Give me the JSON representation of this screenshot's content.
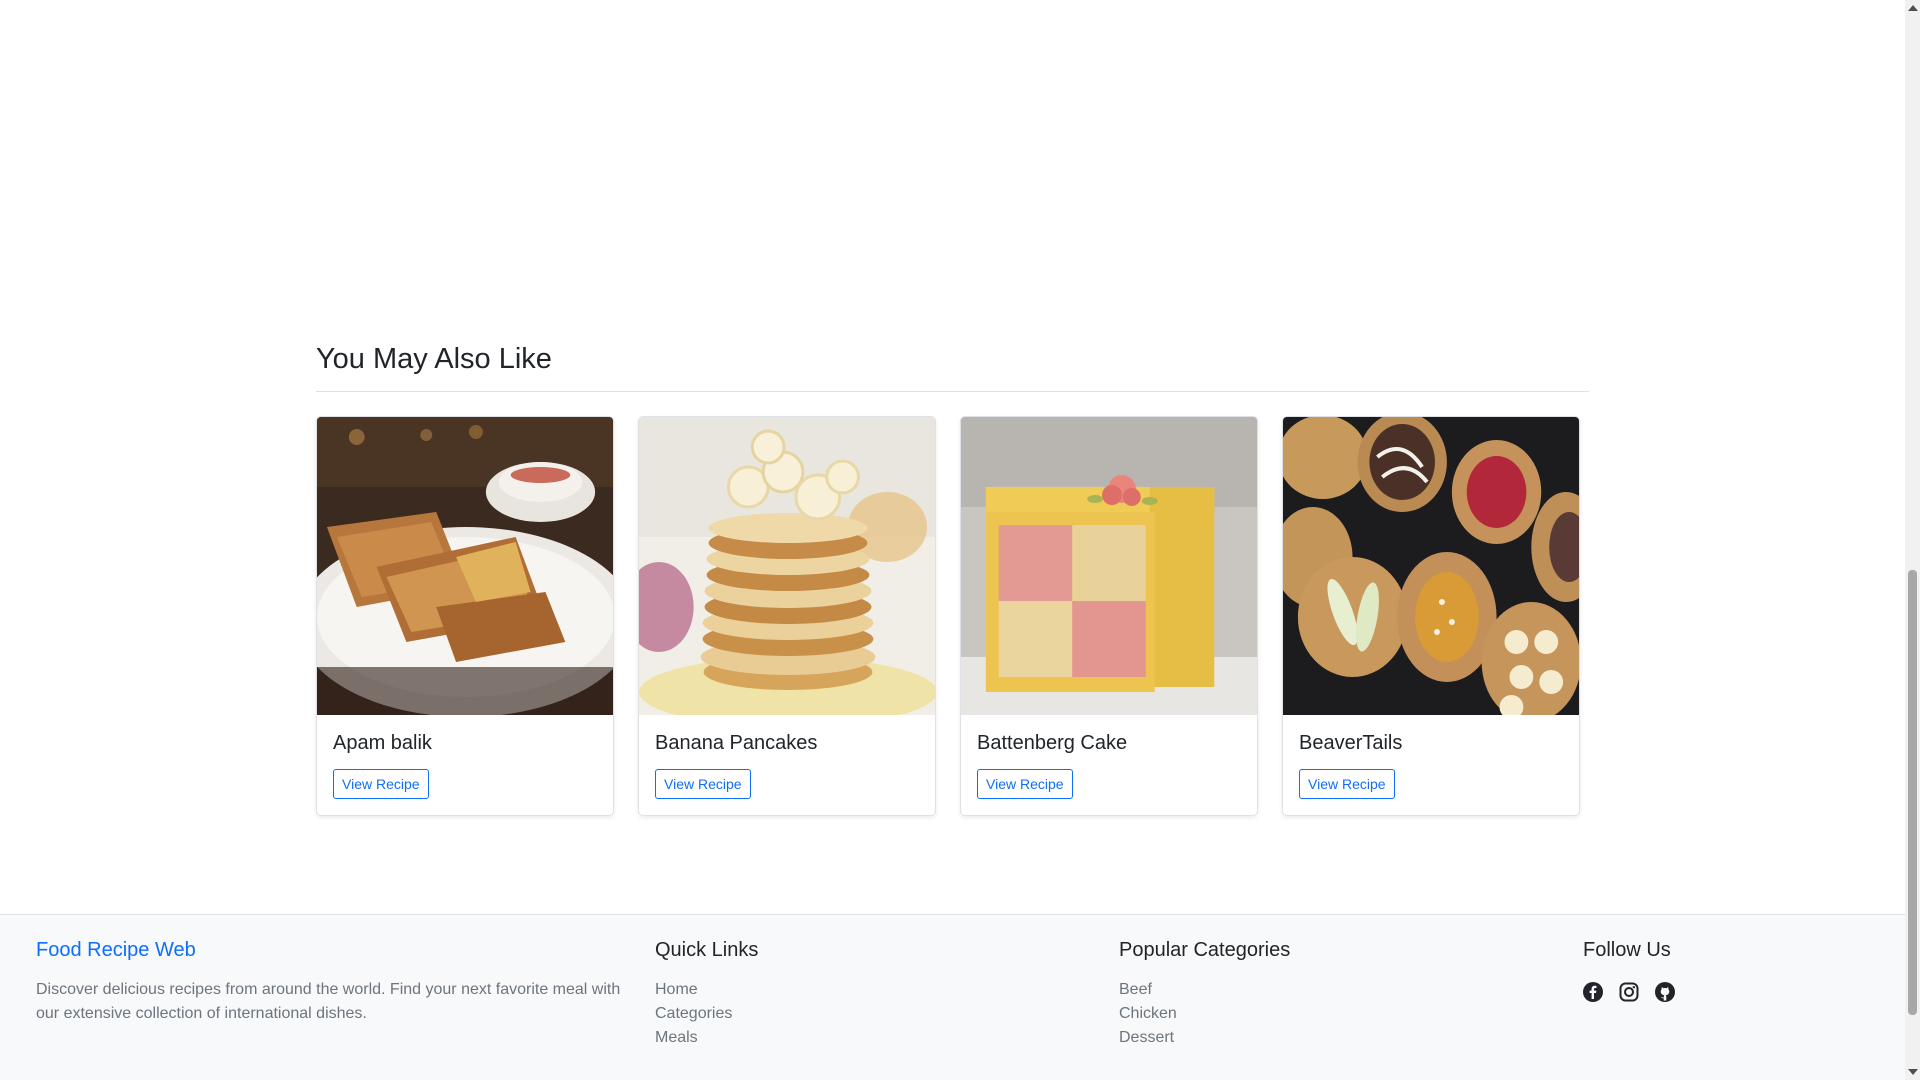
{
  "related": {
    "title": "You May Also Like",
    "cards": [
      {
        "title": "Apam balik",
        "button": "View Recipe"
      },
      {
        "title": "Banana Pancakes",
        "button": "View Recipe"
      },
      {
        "title": "Battenberg Cake",
        "button": "View Recipe"
      },
      {
        "title": "BeaverTails",
        "button": "View Recipe"
      }
    ]
  },
  "footer": {
    "brand": "Food Recipe Web",
    "description": "Discover delicious recipes from around the world. Find your next favorite meal with our extensive collection of international dishes.",
    "quick_links": {
      "heading": "Quick Links",
      "items": [
        "Home",
        "Categories",
        "Meals"
      ]
    },
    "categories": {
      "heading": "Popular Categories",
      "items": [
        "Beef",
        "Chicken",
        "Dessert"
      ]
    },
    "follow": {
      "heading": "Follow Us",
      "icons": [
        "facebook-icon",
        "instagram-icon",
        "github-icon"
      ]
    }
  },
  "colors": {
    "primary": "#0d6efd",
    "footer_bg": "#f8f9fa",
    "muted": "#6c757d"
  }
}
